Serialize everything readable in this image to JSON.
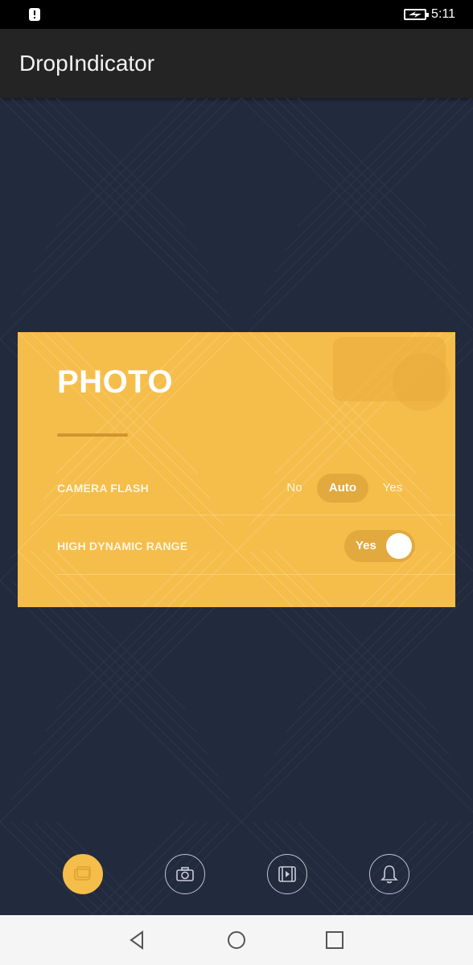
{
  "status_bar": {
    "time": "5:11",
    "icons": [
      "alert-icon",
      "battery-charging-icon"
    ]
  },
  "app_bar": {
    "title": "DropIndicator"
  },
  "card": {
    "title": "PHOTO",
    "background_color": "#f5bd4a",
    "rows": [
      {
        "label": "CAMERA FLASH",
        "control": "segmented",
        "options": [
          "No",
          "Auto",
          "Yes"
        ],
        "selected": "Auto"
      },
      {
        "label": "HIGH DYNAMIC RANGE",
        "control": "toggle",
        "value_label": "Yes",
        "checked": true
      }
    ]
  },
  "bottom_tabs": [
    {
      "icon": "photo-icon",
      "selected": true
    },
    {
      "icon": "camera-icon",
      "selected": false
    },
    {
      "icon": "video-icon",
      "selected": false
    },
    {
      "icon": "bell-icon",
      "selected": false
    }
  ],
  "nav_bar": {
    "buttons": [
      "back-icon",
      "home-icon",
      "recents-icon"
    ]
  },
  "colors": {
    "background": "#222a3d",
    "accent": "#f5bd4a",
    "app_bar": "#242424"
  }
}
